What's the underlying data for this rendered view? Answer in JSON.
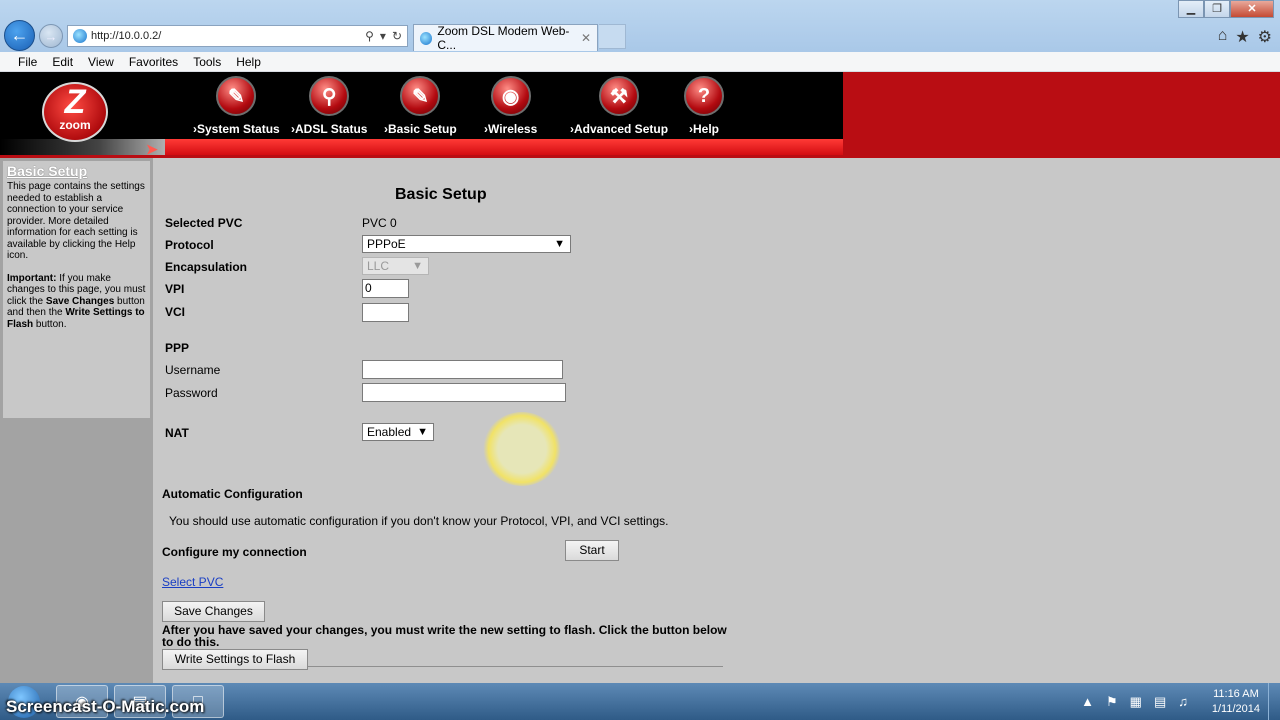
{
  "browser": {
    "url": "http://10.0.0.2/",
    "tab_title": "Zoom DSL Modem Web-C...",
    "tab_close": "✕",
    "menu": [
      "File",
      "Edit",
      "View",
      "Favorites",
      "Tools",
      "Help"
    ],
    "window_controls": {
      "minimize": "▁",
      "restore": "❐",
      "close": "✕"
    },
    "right_tools": {
      "home": "⌂",
      "favorites": "★",
      "settings": "⚙"
    }
  },
  "logo": {
    "glyph": "Z",
    "word": "zoom"
  },
  "nav": [
    {
      "label": "System Status",
      "icon": "system-status-icon"
    },
    {
      "label": "ADSL Status",
      "icon": "adsl-status-icon"
    },
    {
      "label": "Basic Setup",
      "icon": "basic-setup-icon"
    },
    {
      "label": "Wireless",
      "icon": "wireless-icon"
    },
    {
      "label": "Advanced Setup",
      "icon": "advanced-setup-icon"
    },
    {
      "label": "Help",
      "icon": "help-icon"
    }
  ],
  "sidebar": {
    "title": "Basic Setup",
    "description": "This page contains the settings needed to establish a connection to your service provider. More detailed information for each setting is available by clicking the Help icon.",
    "important_label": "Important:",
    "important_text_1": " If you make changes to this page, you must click the ",
    "save_changes": "Save Changes",
    "important_text_2": " button and then the ",
    "write_settings": "Write Settings to Flash",
    "important_text_3": " button."
  },
  "form": {
    "title": "Basic Setup",
    "selected_pvc_label": "Selected PVC",
    "selected_pvc_value": "PVC 0",
    "protocol_label": "Protocol",
    "protocol_value": "PPPoE",
    "encapsulation_label": "Encapsulation",
    "encapsulation_value": "LLC",
    "vpi_label": "VPI",
    "vpi_value": "0",
    "vci_label": "VCI",
    "vci_value": "",
    "ppp_label": "PPP",
    "username_label": "Username",
    "username_value": "",
    "password_label": "Password",
    "password_value": "",
    "nat_label": "NAT",
    "nat_value": "Enabled",
    "auto_config_label": "Automatic Configuration",
    "auto_config_hint": "You should use automatic configuration if you don't know your Protocol, VPI, and VCI settings.",
    "configure_label": "Configure my connection",
    "start_button": "Start",
    "select_pvc_link": "Select PVC",
    "save_changes_button": "Save Changes",
    "flash_note": "After you have saved your changes, you must write the new setting to flash. Click the button below to do this.",
    "write_flash_button": "Write Settings to Flash"
  },
  "taskbar": {
    "watermark": "Screencast-O-Matic.com",
    "time": "11:16 AM",
    "date": "1/11/2014"
  },
  "colors": {
    "header_red": "#b90d13",
    "page_gray": "#c8c8c8",
    "sidebar_gray": "#a3a3a3",
    "link_blue": "#1a3fc4"
  }
}
